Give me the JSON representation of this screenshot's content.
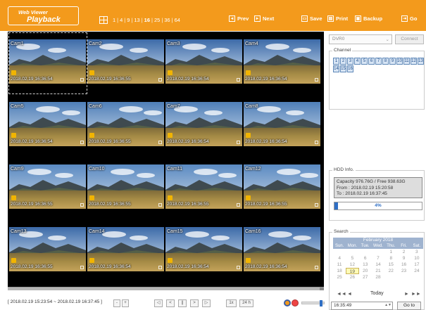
{
  "header": {
    "logo_line1": "Web Viewer",
    "logo_line2": "Playback",
    "split_options": [
      "1",
      "4",
      "9",
      "13",
      "16",
      "25",
      "36",
      "64"
    ],
    "split_active": "16",
    "prev_label": "Prev",
    "next_label": "Next",
    "save_label": "Save",
    "print_label": "Print",
    "backup_label": "Backup",
    "go_label": "Go",
    "accent_color": "#f39a1c"
  },
  "cameras": [
    {
      "label": "Cam1",
      "timestamp": "2018.02.19 16:36:54"
    },
    {
      "label": "Cam2",
      "timestamp": "2018.02.19 16:36:55"
    },
    {
      "label": "Cam3",
      "timestamp": "2018.02.19 16:36:54"
    },
    {
      "label": "Cam4",
      "timestamp": "2018.02.19 16:36:54"
    },
    {
      "label": "Cam5",
      "timestamp": "2018.02.19 16:36:54"
    },
    {
      "label": "Cam6",
      "timestamp": "2018.02.19 16:36:55"
    },
    {
      "label": "Cam7",
      "timestamp": "2018.02.19 16:36:54"
    },
    {
      "label": "Cam8",
      "timestamp": "2018.02.19 16:36:54"
    },
    {
      "label": "Cam9",
      "timestamp": "2018.02.19 16:36:55"
    },
    {
      "label": "Cam10",
      "timestamp": "2018.02.19 16:36:55"
    },
    {
      "label": "Cam11",
      "timestamp": "2018.02.19 16:36:55"
    },
    {
      "label": "Cam12",
      "timestamp": "2018.02.19 16:36:55"
    },
    {
      "label": "Cam13",
      "timestamp": "2018.02.19 16:36:55"
    },
    {
      "label": "Cam14",
      "timestamp": "2018.02.19 16:36:54"
    },
    {
      "label": "Cam15",
      "timestamp": "2018.02.19 16:36:54"
    },
    {
      "label": "Cam16",
      "timestamp": "2018.02.19 16:36:54"
    }
  ],
  "panel": {
    "dvr_select": "DVR0",
    "connect_label": "Connect",
    "channel_legend": "Channel",
    "channels": [
      "1",
      "2",
      "3",
      "4",
      "5",
      "6",
      "7",
      "8",
      "9",
      "10",
      "11",
      "12",
      "13",
      "14",
      "15",
      "16"
    ],
    "hdd_legend": "HDD Info.",
    "hdd_capacity": "Capacity 976.76G / Free 938.63G",
    "hdd_from": "From : 2018.02.19 15:20:58",
    "hdd_to": "To : 2018.02.19 16:37:45",
    "hdd_percent_label": "4%",
    "hdd_used_fraction": 0.04,
    "search_legend": "Search",
    "calendar_title": "February 2018",
    "weekdays": [
      "Sun.",
      "Mon.",
      "Tue.",
      "Wed.",
      "Thu.",
      "Fri.",
      "Sat."
    ],
    "days": [
      "",
      "",
      "",
      "",
      "1",
      "2",
      "3",
      "4",
      "5",
      "6",
      "7",
      "8",
      "9",
      "10",
      "11",
      "12",
      "13",
      "14",
      "15",
      "16",
      "17",
      "18",
      "19",
      "20",
      "21",
      "22",
      "23",
      "24",
      "25",
      "26",
      "27",
      "28",
      "",
      "",
      ""
    ],
    "selected_day": "19",
    "nav_prev_year": "◄◄",
    "nav_prev_month": "◄",
    "today_label": "Today",
    "nav_next_month": "►",
    "nav_next_year": "►►",
    "time_value": "16:35:49",
    "goto_label": "Go to"
  },
  "bottom": {
    "range_text": "[ 2018.02.19 15:23:54 ~ 2018.02.19 16:37:45 ]",
    "zoom_out": "-",
    "zoom_in": "+",
    "btn_first": "◁",
    "btn_prev": "<",
    "btn_pause": "||",
    "btn_next": ">",
    "btn_last": "▷",
    "speed_1x": "1x",
    "speed_24h": "24 h",
    "volume_level": 0.85
  }
}
